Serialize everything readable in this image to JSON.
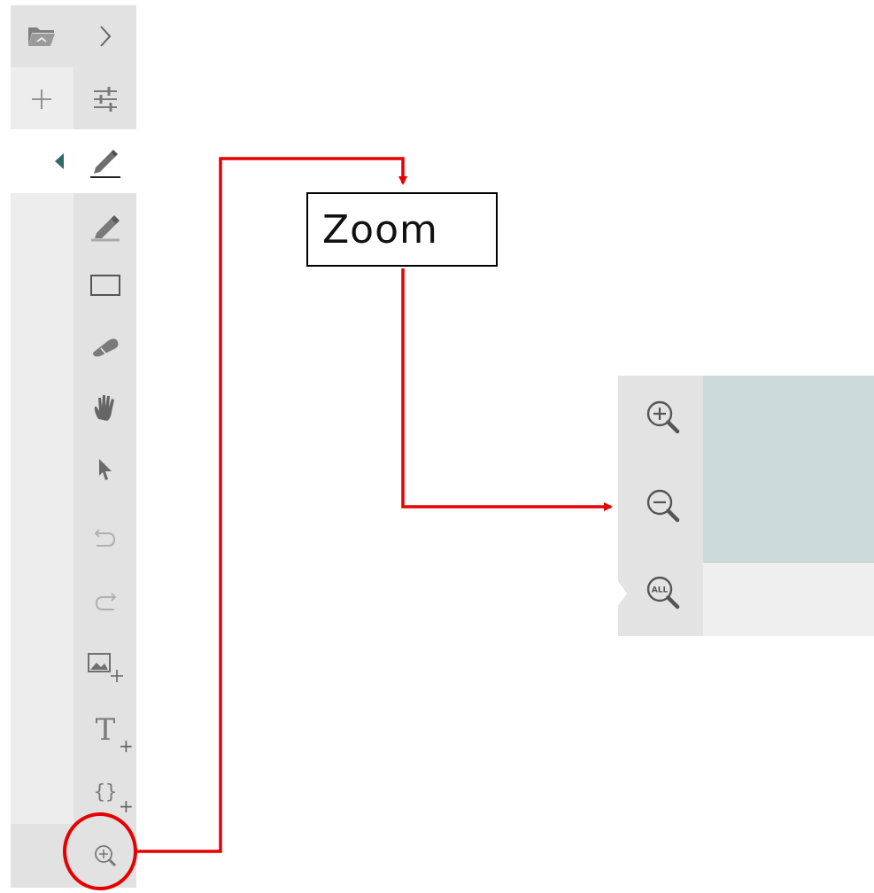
{
  "toolbar": {
    "buttons": [
      {
        "name": "open-folder-button",
        "icon": "folder-open-icon"
      },
      {
        "name": "expand-button",
        "icon": "chevron-right-icon"
      },
      {
        "name": "new-button",
        "icon": "plus-icon"
      },
      {
        "name": "settings-button",
        "icon": "sliders-icon"
      },
      {
        "name": "pen-button",
        "icon": "pen-icon",
        "active": true
      },
      {
        "name": "highlighter-button",
        "icon": "highlighter-icon"
      },
      {
        "name": "rectangle-button",
        "icon": "rectangle-icon"
      },
      {
        "name": "eraser-button",
        "icon": "eraser-icon"
      },
      {
        "name": "pan-button",
        "icon": "hand-icon"
      },
      {
        "name": "select-button",
        "icon": "pointer-icon"
      },
      {
        "name": "undo-button",
        "icon": "undo-icon"
      },
      {
        "name": "redo-button",
        "icon": "redo-icon"
      },
      {
        "name": "insert-image-button",
        "icon": "image-add-icon"
      },
      {
        "name": "insert-text-button",
        "icon": "text-add-icon"
      },
      {
        "name": "insert-equation-button",
        "icon": "braces-add-icon"
      },
      {
        "name": "zoom-button",
        "icon": "zoom-icon"
      }
    ],
    "text_tool_glyph": "T",
    "equation_tool_glyph": "{}",
    "add_glyph": "+"
  },
  "callout": {
    "label": "Zoom"
  },
  "zoom_panel": {
    "buttons": [
      {
        "name": "zoom-in-button",
        "icon": "zoom-in-icon"
      },
      {
        "name": "zoom-out-button",
        "icon": "zoom-out-icon"
      },
      {
        "name": "zoom-all-button",
        "icon": "zoom-all-icon",
        "label": "ALL"
      }
    ]
  },
  "colors": {
    "annotation": "#e60000",
    "toolbar_bg": "#ededed",
    "toolbar_header_bg": "#e2e2e2",
    "accent": "#2e6b6b",
    "canvas": "#ccdada",
    "icon": "#777777"
  }
}
